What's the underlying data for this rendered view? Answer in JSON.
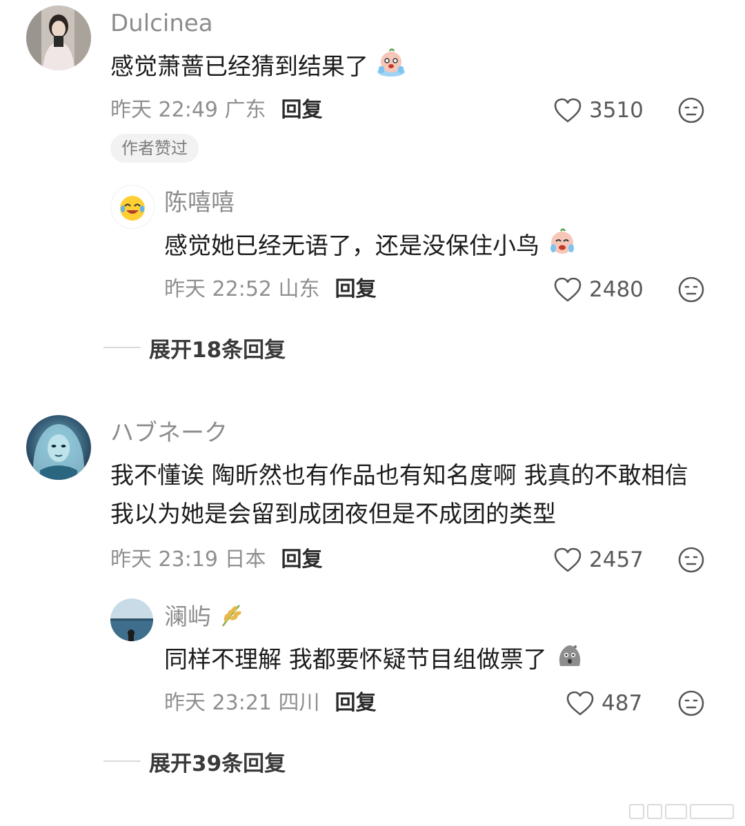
{
  "comments": [
    {
      "username": "Dulcinea",
      "text": "感觉萧蔷已经猜到结果了",
      "time": "昨天 22:49 广东",
      "reply_label": "回复",
      "likes": "3510",
      "badge": "作者赞过",
      "reply": {
        "username": "陈嘻嘻",
        "text": "感觉她已经无语了，还是没保住小鸟",
        "time": "昨天 22:52 山东",
        "reply_label": "回复",
        "likes": "2480"
      },
      "expand_label": "展开18条回复"
    },
    {
      "username": "ハブネーク",
      "text_lines": [
        "我不懂诶 陶昕然也有作品也有知名度啊 我真的不敢相信",
        "我以为她是会留到成团夜但是不成团的类型"
      ],
      "time": "昨天 23:19 日本",
      "reply_label": "回复",
      "likes": "2457",
      "reply": {
        "username": "澜屿",
        "text": "同样不理解 我都要怀疑节目组做票了",
        "time": "昨天 23:21 四川",
        "reply_label": "回复",
        "likes": "487"
      },
      "expand_label": "展开39条回复"
    }
  ],
  "icons": {
    "like": "heart-outline-icon",
    "dislike": "meh-face-icon",
    "wheat": "wheat-icon"
  },
  "colors": {
    "meta_gray": "#8f8f8f",
    "badge_bg": "#f2f2f2",
    "text": "#1c1c1c"
  }
}
